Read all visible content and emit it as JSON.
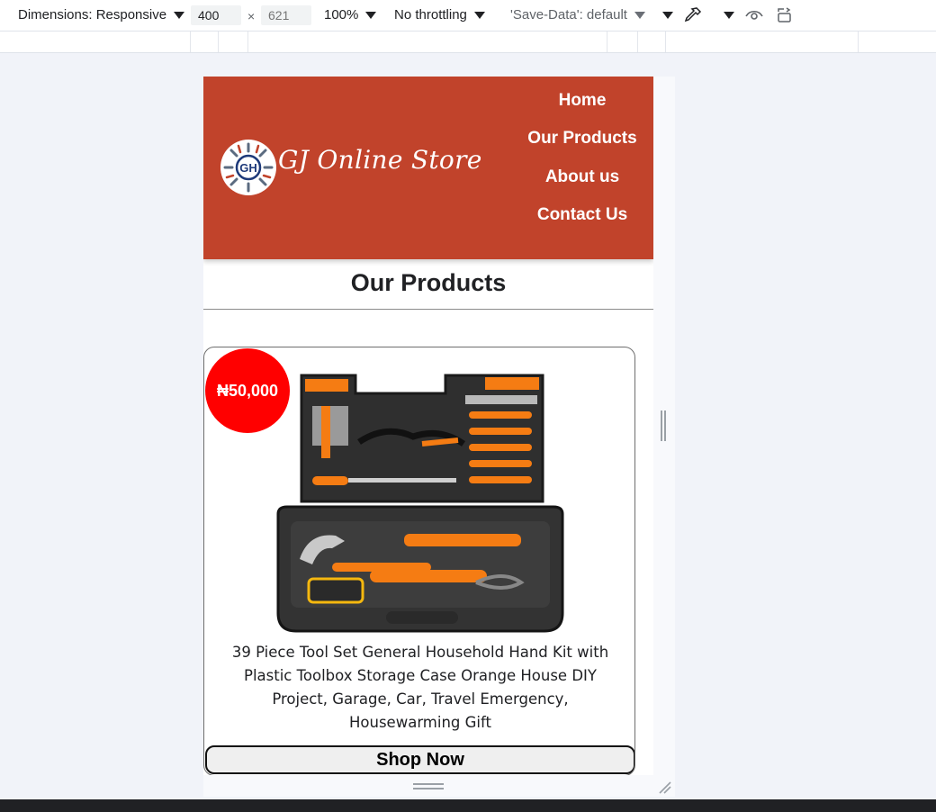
{
  "devtools": {
    "dimensions_label": "Dimensions: Responsive",
    "width_value": "400",
    "times": "×",
    "height_placeholder": "621",
    "zoom": "100%",
    "throttling": "No throttling",
    "save_data": "'Save-Data': default"
  },
  "site": {
    "brand": "GJ Online Store",
    "logo_text": "GH",
    "nav": [
      "Home",
      "Our Products",
      "About us",
      "Contact Us"
    ],
    "section_title": "Our Products"
  },
  "product": {
    "price": "₦50,000",
    "description": "39 Piece Tool Set General Household Hand Kit with Plastic Toolbox Storage Case Orange House DIY Project, Garage, Car, Travel Emergency, Housewarming Gift",
    "button": "Shop Now"
  },
  "colors": {
    "header_bg": "#c1432b",
    "price_badge": "#ff0000",
    "tool_orange": "#f57c13"
  }
}
